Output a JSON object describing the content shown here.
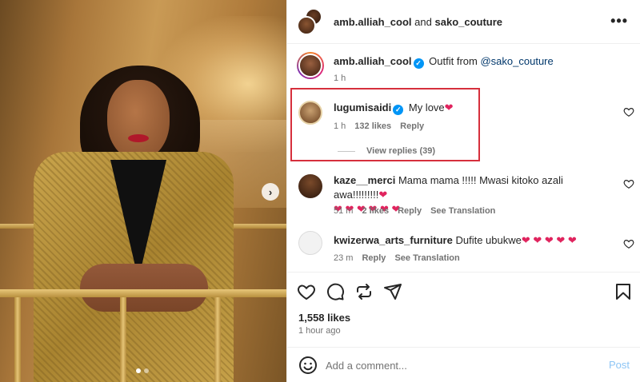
{
  "header": {
    "user1": "amb.alliah_cool",
    "and": "and",
    "user2": "sako_couture",
    "more_label": "•••"
  },
  "caption": {
    "username": "amb.alliah_cool",
    "text": "Outfit from",
    "mention": "@sako_couture",
    "time": "1 h"
  },
  "comments": [
    {
      "username": "lugumisaidi",
      "verified": true,
      "text": "My love",
      "emoji": "❤",
      "time": "1 h",
      "likes": "132 likes",
      "reply": "Reply",
      "view_replies": "View replies (39)"
    },
    {
      "username": "kaze__merci",
      "text": "Mama mama !!!!! Mwasi kitoko azali awa!!!!!!!!!",
      "emoji_line1": "❤",
      "emoji_line2": "❤ ❤ ❤ ❤ ❤ ❤",
      "time": "51 m",
      "likes": "2 likes",
      "reply": "Reply",
      "translate": "See Translation"
    },
    {
      "username": "kwizerwa_arts_furniture",
      "text": "Dufite ubukwe",
      "emoji": "❤ ❤ ❤ ❤ ❤",
      "time": "23 m",
      "reply": "Reply",
      "translate": "See Translation"
    }
  ],
  "post_stats": {
    "likes": "1,558 likes",
    "time": "1 hour ago"
  },
  "comment_box": {
    "placeholder": "Add a comment...",
    "post_label": "Post"
  },
  "carousel": {
    "next": "›",
    "active_index": 0,
    "total": 2
  },
  "colors": {
    "verified": "#0095f6",
    "highlight_border": "#d62f3c",
    "mention": "#00376b",
    "heart_emoji": "#e0245e",
    "post_disabled": "#8dc5f5"
  }
}
